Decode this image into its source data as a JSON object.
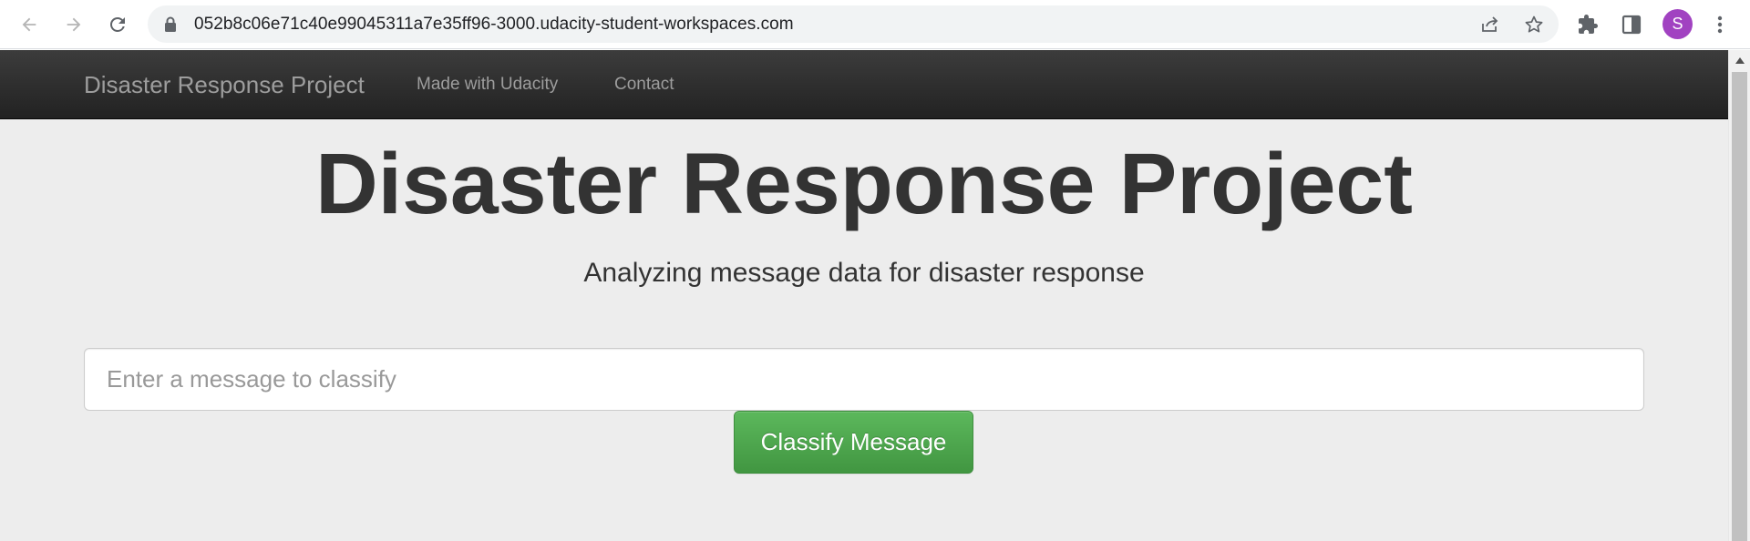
{
  "browser": {
    "url": "052b8c06e71c40e99045311a7e35ff96-3000.udacity-student-workspaces.com",
    "profile_initial": "S",
    "profile_color": "#a142c1",
    "icons": {
      "back": "arrow-left-icon",
      "forward": "arrow-right-icon",
      "reload": "reload-icon",
      "lock": "lock-icon",
      "share": "share-icon",
      "bookmark": "star-icon",
      "extensions": "puzzle-icon",
      "side_panel": "side-panel-icon",
      "menu": "kebab-menu-icon"
    }
  },
  "navbar": {
    "brand": "Disaster Response Project",
    "links": [
      "Made with Udacity",
      "Contact"
    ]
  },
  "jumbotron": {
    "title": "Disaster Response Project",
    "subtitle": "Analyzing message data for disaster response",
    "input_placeholder": "Enter a message to classify",
    "input_value": "",
    "button_label": "Classify Message"
  },
  "colors": {
    "navbar": "#222222",
    "page_bg": "#ededed",
    "button_green": "#5cb85c"
  }
}
